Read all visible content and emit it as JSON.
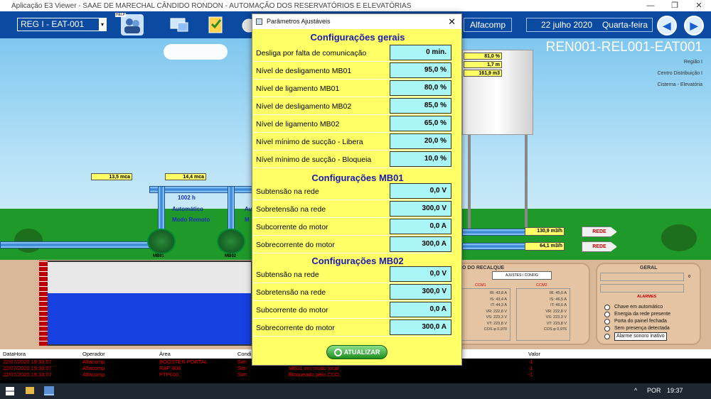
{
  "window": {
    "title": "Aplicação E3 Viewer - SAAE DE MARECHAL CÂNDIDO RONDON - AUTOMAÇÃO DOS RESERVATÓRIOS E ELEVATÓRIAS",
    "btn_min": "—",
    "btn_max": "❐",
    "btn_close": "✕"
  },
  "topbar": {
    "station_select": "REG I   - EAT-001",
    "user": "Alfacomp",
    "date": "22 julho 2020",
    "weekday": "Quarta-feira",
    "nav_back": "◀",
    "nav_fwd": "▶",
    "help_label": "HELP"
  },
  "scene": {
    "station_code": "REN001-REL001-EAT001",
    "region": "Região I",
    "distribution": "Centro Distribuição I",
    "location": "Cisterna - Elevatória",
    "mb01_pressure": "13,5 mca",
    "mb02_pressure": "14,4 mca",
    "mb01_hours": "1002  h",
    "mb01_mode": "Automático",
    "mb01_remote": "Modo Remoto",
    "mb01_label": "MB01",
    "mb02_label": "MB02",
    "mb02_mode_partial": "Au",
    "mb02_remote_partial": "M",
    "tank_level_pct": "81,0 %",
    "tank_level_m": "1,7 m",
    "tank_volume": "161,9 m3",
    "flow1": "130,9 m3/h",
    "flow2": "64,1 m3/h",
    "rede1": "REDE",
    "rede2": "REDE"
  },
  "panels": {
    "recalque_title": "O DO RECALQUE",
    "ajustes_btn": "AJUSTES / CONFIG",
    "ccm1": "CCM1",
    "ccm2": "CCM2",
    "ccm1_values": [
      "IR: 43,8 A",
      "IS: 43,4 A",
      "IT: 44,3 A",
      "VR: 222,8 V",
      "VS: 223,3 V",
      "VT: 223,8 V",
      "COS φ 0,970"
    ],
    "ccm2_values": [
      "IR: 45,0 A",
      "IS: 46,5 A",
      "IT: 46,6 A",
      "VR: 222,8 V",
      "VS: 223,3 V",
      "VT: 223,8 V",
      "COS φ 0,976"
    ],
    "geral_title": "GERAL",
    "geral_value": "0",
    "alarmes_title": "ALARMES",
    "alarms": [
      "Chave em automático",
      "Energia da rede presente",
      "Porta do painel fechada",
      "Sem presença detectada",
      "Alarme sonoro inativo"
    ]
  },
  "grid": {
    "headers": [
      "DataHora",
      "Operador",
      "Área",
      "Condi",
      "",
      "Valor"
    ],
    "rows": [
      [
        "22/07/2020 19:33:07",
        "Alfacomp",
        "BOOSTER PORTAL",
        "Sim",
        "",
        "-1"
      ],
      [
        "22/07/2020 19:33:07",
        "Alfacomp",
        "RAP-006",
        "Sim",
        "MB01 em modo local",
        "-1"
      ],
      [
        "22/07/2020 19:33:07",
        "Alfacomp",
        "PTP010",
        "Sim",
        "Bloqueado pelo CCO",
        "-1"
      ]
    ]
  },
  "taskbar": {
    "lang": "POR",
    "time": "19:37",
    "chevron": "^"
  },
  "dialog": {
    "title": "Parâmetros Ajustáveis",
    "close": "✕",
    "sections": [
      {
        "title": "Configurações gerais",
        "rows": [
          {
            "label": "Desliga por falta de comunicação",
            "value": "0  min."
          },
          {
            "label": "Nível de desligamento MB01",
            "value": "95,0 %"
          },
          {
            "label": "Nível de ligamento MB01",
            "value": "80,0 %"
          },
          {
            "label": "Nível de desligamento MB02",
            "value": "85,0 %"
          },
          {
            "label": "Nível de ligamento MB02",
            "value": "65,0 %"
          },
          {
            "label": "Nível mínimo de sucção - Libera",
            "value": "20,0 %"
          },
          {
            "label": "Nível mínimo de sucção - Bloqueia",
            "value": "10,0 %"
          }
        ]
      },
      {
        "title": "Configurações MB01",
        "rows": [
          {
            "label": "Subtensão na rede",
            "value": "0,0  V"
          },
          {
            "label": "Sobretensão na rede",
            "value": "300,0  V"
          },
          {
            "label": "Subcorrente do motor",
            "value": "0,0  A"
          },
          {
            "label": "Sobrecorrente do motor",
            "value": "300,0  A"
          }
        ]
      },
      {
        "title": "Configurações MB02",
        "rows": [
          {
            "label": "Subtensão na rede",
            "value": "0,0  V"
          },
          {
            "label": "Sobretensão na rede",
            "value": "300,0  V"
          },
          {
            "label": "Subcorrente do motor",
            "value": "0,0  A"
          },
          {
            "label": "Sobrecorrente do motor",
            "value": "300,0  A"
          }
        ]
      }
    ],
    "update_button": "ATUALIZAR"
  }
}
